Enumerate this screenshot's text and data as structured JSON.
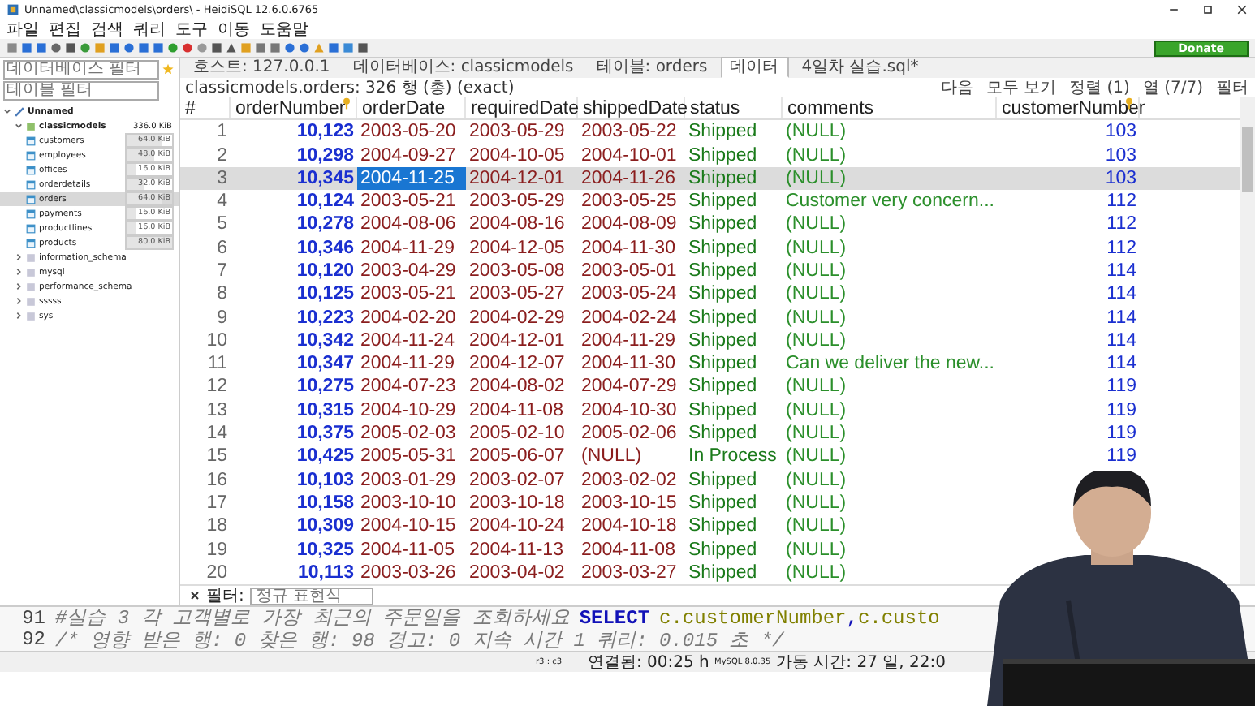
{
  "window": {
    "title": "Unnamed\\classicmodels\\orders\\ - HeidiSQL 12.6.0.6765"
  },
  "menu": [
    "파일",
    "편집",
    "검색",
    "쿼리",
    "도구",
    "이동",
    "도움말"
  ],
  "donate": "Donate",
  "filters": {
    "database_placeholder": "데이터베이스 필터",
    "table_placeholder": "테이블 필터"
  },
  "tabs": [
    {
      "label": "호스트: 127.0.0.1",
      "selected": false
    },
    {
      "label": "데이터베이스: classicmodels",
      "selected": false
    },
    {
      "label": "테이블: orders",
      "selected": false
    },
    {
      "label": "데이터",
      "selected": true
    },
    {
      "label": "4일차 실습.sql*",
      "selected": false
    }
  ],
  "tree": [
    {
      "label": "Unnamed",
      "expanded": true,
      "children": [
        {
          "label": "classicmodels",
          "size": "336.0 KiB",
          "expanded": true,
          "children": [
            {
              "label": "customers",
              "size": "64.0 KiB",
              "level": 0.8,
              "selected": false
            },
            {
              "label": "employees",
              "size": "48.0 KiB",
              "level": 0.6,
              "selected": false
            },
            {
              "label": "offices",
              "size": "16.0 KiB",
              "level": 0.2,
              "selected": false
            },
            {
              "label": "orderdetails",
              "size": "32.0 KiB",
              "level": 0.4,
              "selected": false
            },
            {
              "label": "orders",
              "size": "64.0 KiB",
              "level": 0.8,
              "selected": true
            },
            {
              "label": "payments",
              "size": "16.0 KiB",
              "level": 0.2,
              "selected": false
            },
            {
              "label": "productlines",
              "size": "16.0 KiB",
              "level": 0.2,
              "selected": false
            },
            {
              "label": "products",
              "size": "80.0 KiB",
              "level": 1.0,
              "selected": false
            }
          ]
        },
        {
          "label": "information_schema",
          "expanded": false
        },
        {
          "label": "mysql",
          "expanded": false
        },
        {
          "label": "performance_schema",
          "expanded": false
        },
        {
          "label": "sssss",
          "expanded": false
        },
        {
          "label": "sys",
          "expanded": false
        }
      ]
    }
  ],
  "grid_info": "classicmodels.orders: 326 행 (총) (exact)",
  "grid_actions": [
    "다음",
    "모두 보기",
    "정렬 (1)",
    "열 (7/7)",
    "필터"
  ],
  "table": {
    "columns": [
      {
        "label": "#",
        "kind": "index"
      },
      {
        "label": "orderNumber",
        "kind": "number",
        "key": true
      },
      {
        "label": "orderDate",
        "kind": "date",
        "key": false
      },
      {
        "label": "requiredDate",
        "kind": "date",
        "key": false
      },
      {
        "label": "shippedDate",
        "kind": "date",
        "key": false
      },
      {
        "label": "status",
        "kind": "text",
        "key": false
      },
      {
        "label": "comments",
        "kind": "text",
        "key": false
      },
      {
        "label": "customerNumber",
        "kind": "number",
        "key": true
      }
    ],
    "rows": [
      {
        "selected": false,
        "cells": [
          "1",
          "10,123",
          "2003-05-20",
          "2003-05-29",
          "2003-05-22",
          "Shipped",
          "(NULL)",
          "103"
        ]
      },
      {
        "selected": false,
        "cells": [
          "2",
          "10,298",
          "2004-09-27",
          "2004-10-05",
          "2004-10-01",
          "Shipped",
          "(NULL)",
          "103"
        ]
      },
      {
        "selected": true,
        "cells": [
          "3",
          "10,345",
          "2004-11-25",
          "2004-12-01",
          "2004-11-26",
          "Shipped",
          "(NULL)",
          "103"
        ]
      },
      {
        "selected": false,
        "cells": [
          "4",
          "10,124",
          "2003-05-21",
          "2003-05-29",
          "2003-05-25",
          "Shipped",
          "Customer very concern...",
          "112"
        ]
      },
      {
        "selected": false,
        "cells": [
          "5",
          "10,278",
          "2004-08-06",
          "2004-08-16",
          "2004-08-09",
          "Shipped",
          "(NULL)",
          "112"
        ]
      },
      {
        "selected": false,
        "cells": [
          "6",
          "10,346",
          "2004-11-29",
          "2004-12-05",
          "2004-11-30",
          "Shipped",
          "(NULL)",
          "112"
        ]
      },
      {
        "selected": false,
        "cells": [
          "7",
          "10,120",
          "2003-04-29",
          "2003-05-08",
          "2003-05-01",
          "Shipped",
          "(NULL)",
          "114"
        ]
      },
      {
        "selected": false,
        "cells": [
          "8",
          "10,125",
          "2003-05-21",
          "2003-05-27",
          "2003-05-24",
          "Shipped",
          "(NULL)",
          "114"
        ]
      },
      {
        "selected": false,
        "cells": [
          "9",
          "10,223",
          "2004-02-20",
          "2004-02-29",
          "2004-02-24",
          "Shipped",
          "(NULL)",
          "114"
        ]
      },
      {
        "selected": false,
        "cells": [
          "10",
          "10,342",
          "2004-11-24",
          "2004-12-01",
          "2004-11-29",
          "Shipped",
          "(NULL)",
          "114"
        ]
      },
      {
        "selected": false,
        "cells": [
          "11",
          "10,347",
          "2004-11-29",
          "2004-12-07",
          "2004-11-30",
          "Shipped",
          "Can we deliver the new...",
          "114"
        ]
      },
      {
        "selected": false,
        "cells": [
          "12",
          "10,275",
          "2004-07-23",
          "2004-08-02",
          "2004-07-29",
          "Shipped",
          "(NULL)",
          "119"
        ]
      },
      {
        "selected": false,
        "cells": [
          "13",
          "10,315",
          "2004-10-29",
          "2004-11-08",
          "2004-10-30",
          "Shipped",
          "(NULL)",
          "119"
        ]
      },
      {
        "selected": false,
        "cells": [
          "14",
          "10,375",
          "2005-02-03",
          "2005-02-10",
          "2005-02-06",
          "Shipped",
          "(NULL)",
          "119"
        ]
      },
      {
        "selected": false,
        "cells": [
          "15",
          "10,425",
          "2005-05-31",
          "2005-06-07",
          "(NULL)",
          "In Process",
          "(NULL)",
          "119"
        ]
      },
      {
        "selected": false,
        "cells": [
          "16",
          "10,103",
          "2003-01-29",
          "2003-02-07",
          "2003-02-02",
          "Shipped",
          "(NULL)"
        ]
      },
      {
        "selected": false,
        "cells": [
          "17",
          "10,158",
          "2003-10-10",
          "2003-10-18",
          "2003-10-15",
          "Shipped",
          "(NULL)"
        ]
      },
      {
        "selected": false,
        "cells": [
          "18",
          "10,309",
          "2004-10-15",
          "2004-10-24",
          "2004-10-18",
          "Shipped",
          "(NULL)"
        ]
      },
      {
        "selected": false,
        "cells": [
          "19",
          "10,325",
          "2004-11-05",
          "2004-11-13",
          "2004-11-08",
          "Shipped",
          "(NULL)"
        ]
      },
      {
        "selected": false,
        "cells": [
          "20",
          "10,113",
          "2003-03-26",
          "2003-04-02",
          "2003-03-27",
          "Shipped",
          "(NULL)"
        ]
      }
    ]
  },
  "filter_bar": {
    "label": "필터:",
    "placeholder": "정규 표현식"
  },
  "query": [
    {
      "number": "91",
      "segments": [
        {
          "kind": "comment",
          "text": "#실습 3 각 고객별로 가장 최근의 주문일을 조회하세요"
        },
        {
          "kind": "keyword",
          "text": "SELECT"
        },
        {
          "kind": "ident",
          "text": "c.customerNumber"
        },
        {
          "kind": "punct",
          "text": ","
        },
        {
          "kind": "ident",
          "text": "c.custo"
        }
      ]
    },
    {
      "number": "92",
      "segments": [
        {
          "kind": "comment",
          "text": "/* 영향 받은 행: 0  찾은 행: 98  경고: 0  지속 시간 1 쿼리: 0.015 초 */"
        }
      ]
    }
  ],
  "status_bar": [
    "r3 : c3",
    "연결됨: 00:25 h",
    "MySQL 8.0.35",
    "가동 시간: 27 일, 22:0"
  ]
}
